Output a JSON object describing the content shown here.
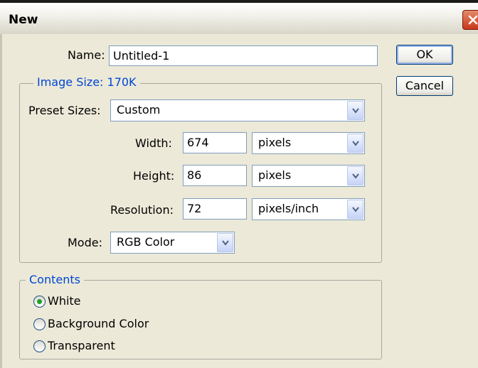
{
  "window": {
    "title": "New"
  },
  "name_field": {
    "label": "Name:",
    "value": "Untitled-1"
  },
  "buttons": {
    "ok": "OK",
    "cancel": "Cancel"
  },
  "image_size": {
    "legend": "Image Size: 170K",
    "preset": {
      "label": "Preset Sizes:",
      "value": "Custom"
    },
    "width": {
      "label": "Width:",
      "value": "674",
      "unit": "pixels"
    },
    "height": {
      "label": "Height:",
      "value": "86",
      "unit": "pixels"
    },
    "resolution": {
      "label": "Resolution:",
      "value": "72",
      "unit": "pixels/inch"
    },
    "mode": {
      "label": "Mode:",
      "value": "RGB Color"
    }
  },
  "contents": {
    "legend": "Contents",
    "options": [
      "White",
      "Background Color",
      "Transparent"
    ],
    "selected": "White"
  },
  "icons": {
    "close": "close-icon",
    "dropdown": "chevron-down-icon"
  }
}
